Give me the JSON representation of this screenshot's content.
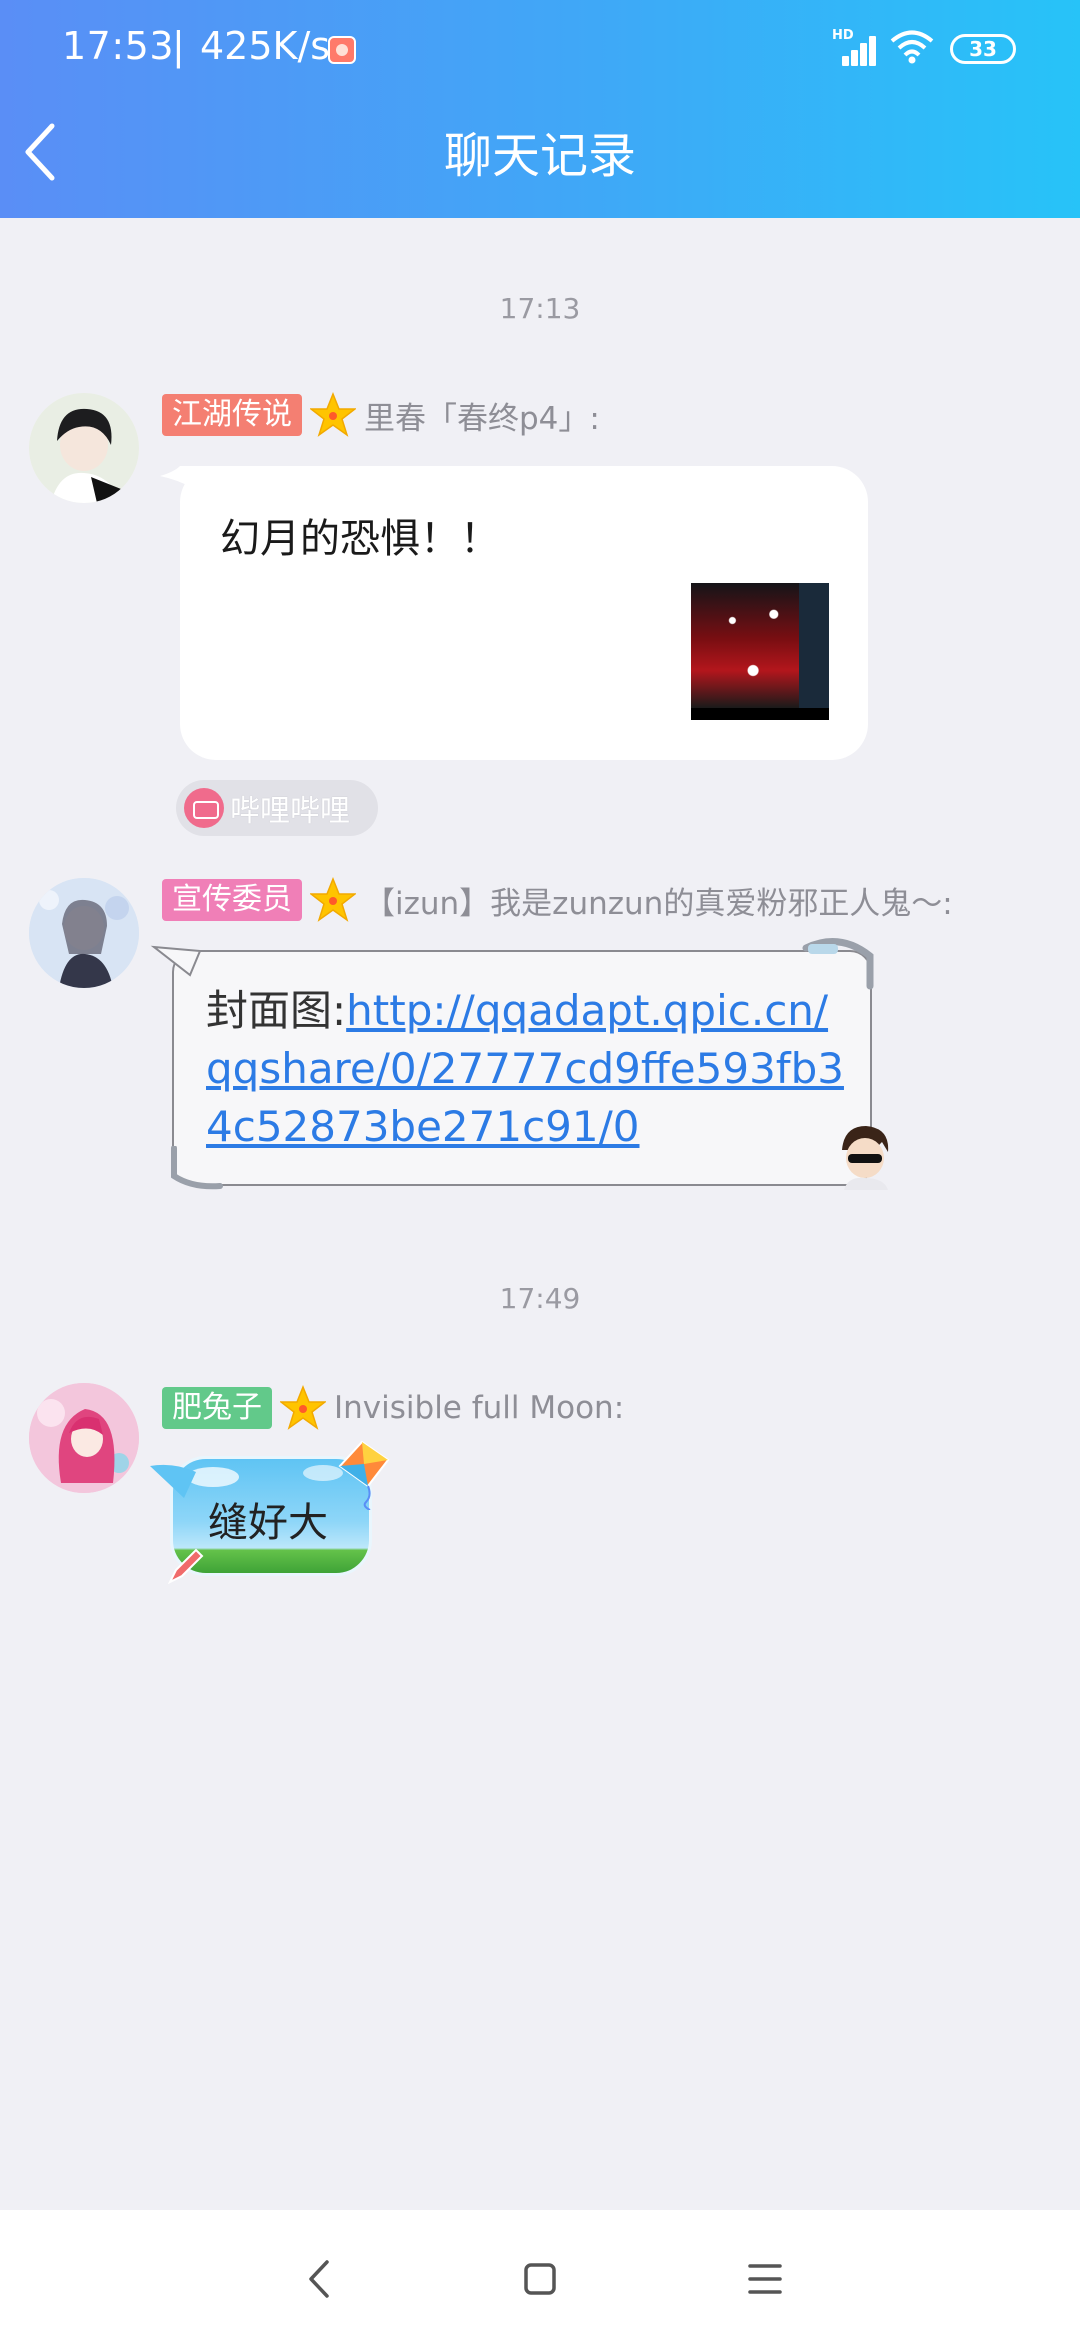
{
  "status_bar": {
    "time": "17:53",
    "separator": "|",
    "net_speed": "425K/s",
    "signal_label": "HD",
    "battery": "33"
  },
  "header": {
    "title": "聊天记录",
    "back_icon": "chevron-left-icon"
  },
  "messages": [
    {
      "time_divider": "17:13",
      "badge": "江湖传说",
      "badge_color": "#f47f72",
      "sender": "里春「春终p4」:",
      "text": "幻月的恐惧！！",
      "source": "哔哩哔哩"
    },
    {
      "badge": "宣传委员",
      "badge_color": "#f07fb7",
      "sender": "【izun】我是zunzun的真爱粉邪正人鬼～:",
      "text_prefix": "封面图:",
      "link": "http://qqadapt.qpic.cn/qqshare/0/27777cd9ffe593fb34c52873be271c91/0"
    },
    {
      "time_divider": "17:49",
      "badge": "肥兔子",
      "badge_color": "#62c98a",
      "sender": "Invisible full Moon:",
      "text": "缝好大"
    }
  ],
  "nav": {
    "back": "back-icon",
    "home": "home-icon",
    "menu": "menu-icon"
  }
}
